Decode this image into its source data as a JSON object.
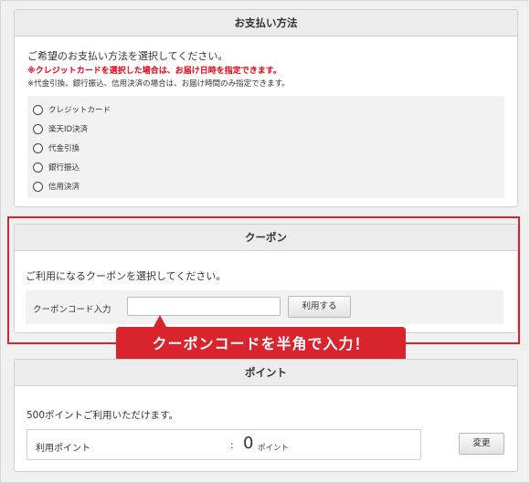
{
  "payment": {
    "title": "お支払い方法",
    "intro": "ご希望のお支払い方法を選択してください。",
    "warning": "※クレジットカードを選択した場合は、お届け日時を指定できます。",
    "note": "※代金引換、銀行振込、信用決済の場合は、お届け時間のみ指定できます。",
    "options": [
      {
        "label": "クレジットカード"
      },
      {
        "label": "楽天ID決済"
      },
      {
        "label": "代金引換"
      },
      {
        "label": "銀行振込"
      },
      {
        "label": "信用決済"
      }
    ]
  },
  "coupon": {
    "title": "クーポン",
    "intro": "ご利用になるクーポンを選択してください。",
    "input_label": "クーポンコード入力",
    "input_value": "",
    "apply_label": "利用する",
    "callout": "クーポンコードを半角で入力！"
  },
  "point": {
    "title": "ポイント",
    "intro": "500ポイントご利用いただけます。",
    "use_label": "利用ポイント",
    "separator": ":",
    "value": "0",
    "unit": "ポイント",
    "change_label": "変更"
  },
  "colors": {
    "accent_red": "#d9232d",
    "warning_red": "#e60012"
  }
}
